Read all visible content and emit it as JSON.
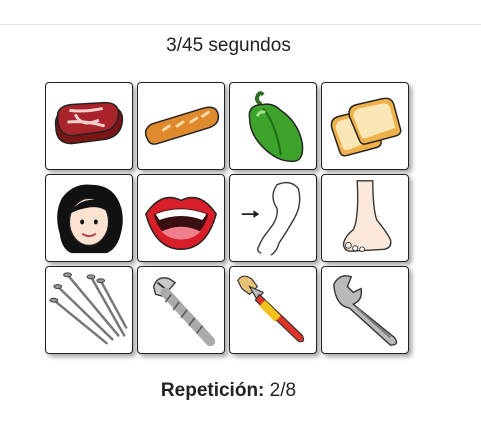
{
  "timer": {
    "text": "3/45 segundos"
  },
  "cards": [
    {
      "icon": "meat-icon"
    },
    {
      "icon": "bread-icon"
    },
    {
      "icon": "green-pepper-icon"
    },
    {
      "icon": "toast-slices-icon"
    },
    {
      "icon": "girl-face-icon"
    },
    {
      "icon": "mouth-icon"
    },
    {
      "icon": "arm-icon"
    },
    {
      "icon": "foot-icon"
    },
    {
      "icon": "nails-icon"
    },
    {
      "icon": "screw-icon"
    },
    {
      "icon": "paintbrush-icon"
    },
    {
      "icon": "wrench-icon"
    }
  ],
  "repetition": {
    "label": "Repetición:",
    "value": "2/8"
  }
}
